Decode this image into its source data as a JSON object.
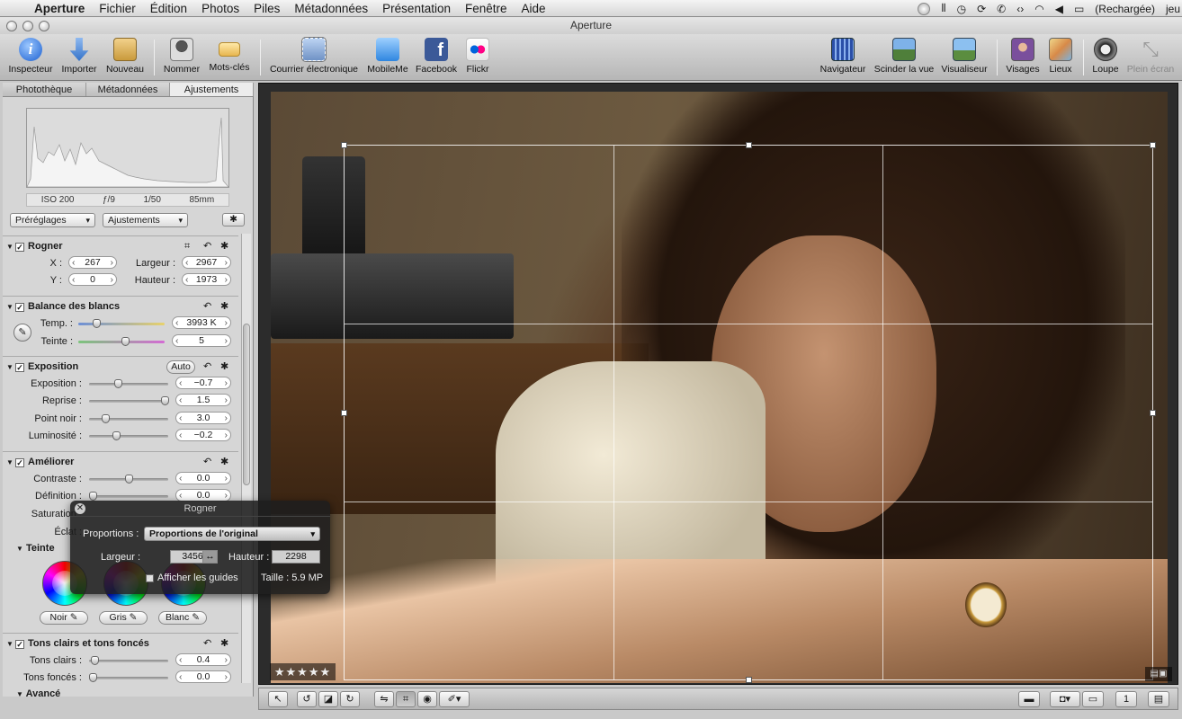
{
  "menubar": {
    "app": "Aperture",
    "items": [
      "Fichier",
      "Édition",
      "Photos",
      "Piles",
      "Métadonnées",
      "Présentation",
      "Fenêtre",
      "Aide"
    ],
    "battery": "(Rechargée)",
    "user": "jeu"
  },
  "window": {
    "title": "Aperture"
  },
  "toolbar": {
    "inspector": "Inspecteur",
    "import": "Importer",
    "new": "Nouveau",
    "name": "Nommer",
    "keywords": "Mots-clés",
    "email": "Courrier électronique",
    "mobileme": "MobileMe",
    "facebook": "Facebook",
    "flickr": "Flickr",
    "navigator": "Navigateur",
    "split": "Scinder la vue",
    "viewer": "Visualiseur",
    "faces": "Visages",
    "places": "Lieux",
    "loupe": "Loupe",
    "fullscreen": "Plein écran"
  },
  "inspector": {
    "tabs": [
      "Photothèque",
      "Métadonnées",
      "Ajustements"
    ],
    "exif": [
      "ISO 200",
      "ƒ/9",
      "1/50",
      "85mm"
    ],
    "presets": "Préréglages",
    "adjustments": "Ajustements",
    "crop": {
      "title": "Rogner",
      "x_label": "X :",
      "x": "267",
      "y_label": "Y :",
      "y": "0",
      "w_label": "Largeur :",
      "w": "2967",
      "h_label": "Hauteur :",
      "h": "1973"
    },
    "wb": {
      "title": "Balance des blancs",
      "temp_label": "Temp. :",
      "temp": "3993 K",
      "tint_label": "Teinte :",
      "tint": "5"
    },
    "exposure": {
      "title": "Exposition",
      "auto": "Auto",
      "exp_label": "Exposition :",
      "exp": "−0.7",
      "rec_label": "Reprise :",
      "rec": "1.5",
      "black_label": "Point noir :",
      "black": "3.0",
      "bright_label": "Luminosité :",
      "bright": "−0.2"
    },
    "enhance": {
      "title": "Améliorer",
      "contrast_label": "Contraste :",
      "contrast": "0.0",
      "def_label": "Définition :",
      "def": "0.0",
      "sat_label": "Saturation :",
      "vib_label": "Éclat :",
      "tint_title": "Teinte",
      "black_btn": "Noir",
      "gray_btn": "Gris",
      "white_btn": "Blanc"
    },
    "shadows": {
      "title": "Tons clairs et tons foncés",
      "hl_label": "Tons clairs :",
      "hl": "0.4",
      "sh_label": "Tons foncés :",
      "sh": "0.0",
      "advanced": "Avancé"
    }
  },
  "hud": {
    "title": "Rogner",
    "prop_label": "Proportions :",
    "prop_value": "Proportions de l'original",
    "w_label": "Largeur :",
    "w": "3456",
    "h_label": "Hauteur :",
    "h": "2298",
    "guides": "Afficher les guides",
    "size": "Taille : 5.9 MP"
  },
  "viewer": {
    "rating": "★★★★★"
  }
}
